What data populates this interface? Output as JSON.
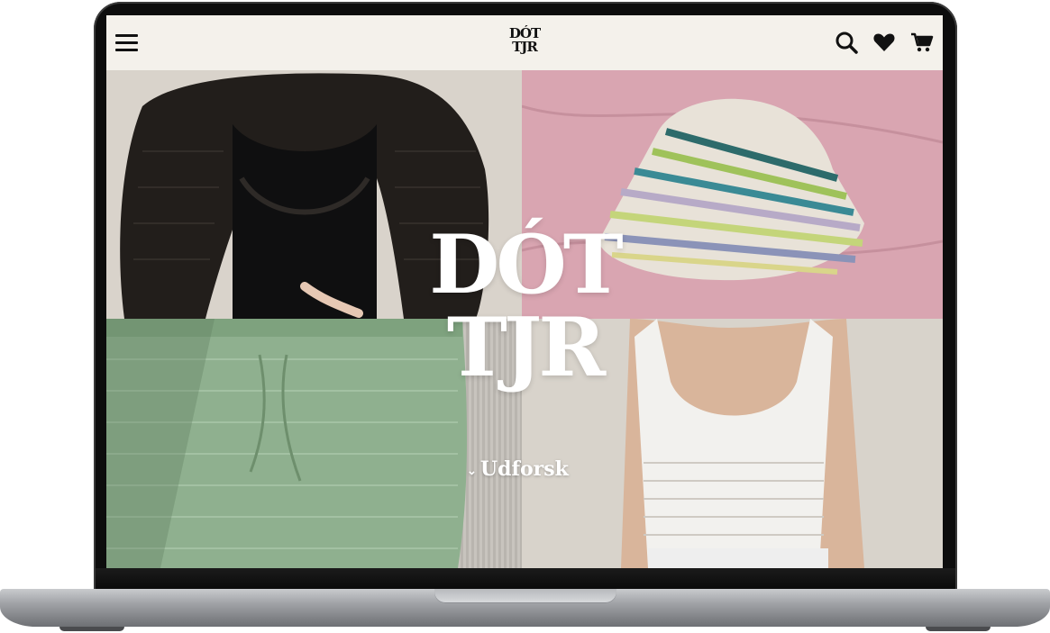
{
  "navbar": {
    "logo_line1": "DÓT",
    "logo_line2": "TJR",
    "icons": [
      "menu-icon",
      "search-icon",
      "heart-icon",
      "cart-icon"
    ]
  },
  "hero": {
    "logo_line1": "DÓT",
    "logo_line2": "TJR",
    "explore_label": "Udforsk",
    "explore_icon": "chevron-down-icon",
    "photos": [
      "black crochet shrug",
      "striped crochet bucket hat",
      "green crochet skirt",
      "white crochet halter top"
    ]
  },
  "colors": {
    "navbar_bg": "#f4f1eb",
    "logo_text": "#111111",
    "hero_text": "#ffffff"
  }
}
